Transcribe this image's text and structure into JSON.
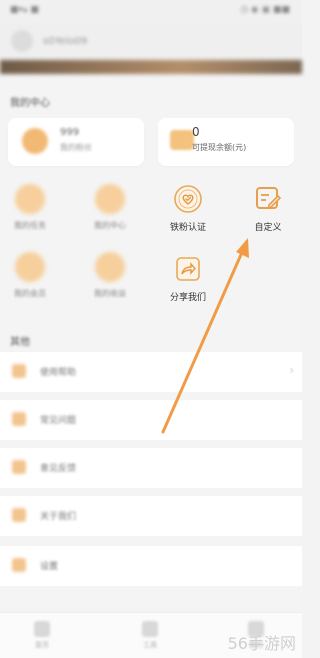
{
  "status_bar": {
    "left": "■▾▴ ■",
    "right": "◷ ◉ ▣ ■■"
  },
  "user": {
    "name": "s0Yelo09"
  },
  "section_my": {
    "title": "我的中心"
  },
  "stats": [
    {
      "value": "999",
      "label": "我的粉丝",
      "icon": "heart-circle-icon"
    },
    {
      "value": "0",
      "label": "可提现余额(元)",
      "icon": "wallet-icon"
    }
  ],
  "grid": [
    {
      "label": "我的任务",
      "icon": "task-icon",
      "clear": false
    },
    {
      "label": "我的中心",
      "icon": "center-icon",
      "clear": false
    },
    {
      "label": "铁粉认证",
      "icon": "heart-badge-icon",
      "clear": true
    },
    {
      "label": "自定义",
      "icon": "edit-note-icon",
      "clear": true
    },
    {
      "label": "我的会员",
      "icon": "crown-icon",
      "clear": false
    },
    {
      "label": "我的收益",
      "icon": "coin-icon",
      "clear": false
    },
    {
      "label": "分享我们",
      "icon": "share-icon",
      "clear": true
    }
  ],
  "section_other": {
    "title": "其他"
  },
  "list": [
    {
      "label": "使用帮助",
      "icon": "help-icon"
    },
    {
      "label": "常见问题",
      "icon": "question-icon"
    },
    {
      "label": "意见反馈",
      "icon": "feedback-icon"
    },
    {
      "label": "关于我们",
      "icon": "about-icon"
    },
    {
      "label": "设置",
      "icon": "settings-icon"
    }
  ],
  "bottom_nav": [
    {
      "label": "首页",
      "icon": "home-icon"
    },
    {
      "label": "工具",
      "icon": "tools-icon"
    },
    {
      "label": "我的",
      "icon": "profile-icon"
    }
  ],
  "watermark": "56手游网",
  "colors": {
    "accent": "#f0a54a",
    "arrow": "#f29b47"
  }
}
